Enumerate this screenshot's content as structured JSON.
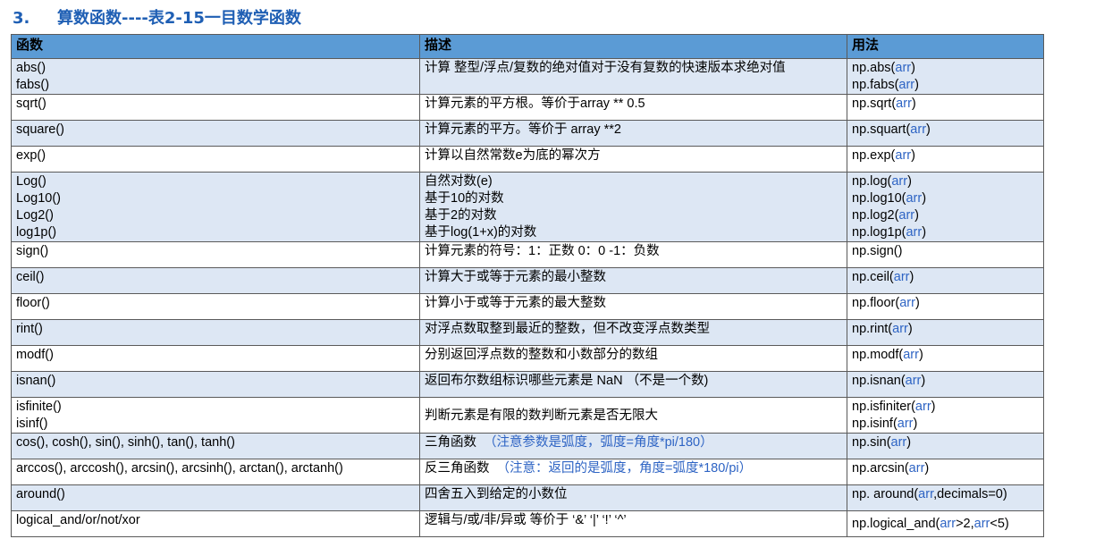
{
  "heading": {
    "number": "3.",
    "title": "算数函数----表2-15一目数学函数"
  },
  "table": {
    "columns": [
      "函数",
      "描述",
      "用法"
    ],
    "rows": [
      {
        "func": [
          "abs()",
          "fabs()"
        ],
        "desc": [
          "计算 整型/浮点/复数的绝对值对于没有复数的快速版本求绝对值"
        ],
        "note": "",
        "usage": [
          [
            "np.abs(",
            "arr",
            ")"
          ],
          [
            "np.fabs(",
            "arr",
            ")"
          ]
        ]
      },
      {
        "func": [
          "sqrt()"
        ],
        "desc": [
          "计算元素的平方根。等价于array ** 0.5"
        ],
        "note": "",
        "usage": [
          [
            "np.sqrt(",
            "arr",
            ")"
          ]
        ]
      },
      {
        "func": [
          "square()"
        ],
        "desc": [
          "计算元素的平方。等价于 array **2"
        ],
        "note": "",
        "usage": [
          [
            "np.squart(",
            "arr",
            ")"
          ]
        ]
      },
      {
        "func": [
          "exp()"
        ],
        "desc": [
          "计算以自然常数e为底的幂次方"
        ],
        "note": "",
        "usage": [
          [
            "np.exp(",
            "arr",
            ")"
          ]
        ]
      },
      {
        "func": [
          "Log()",
          "Log10()",
          "Log2()",
          "log1p()"
        ],
        "desc": [
          "自然对数(e)",
          "基于10的对数",
          "基于2的对数",
          "基于log(1+x)的对数"
        ],
        "note": "",
        "usage": [
          [
            "np.log(",
            "arr",
            ")"
          ],
          [
            "np.log10(",
            "arr",
            ")"
          ],
          [
            "np.log2(",
            "arr",
            ")"
          ],
          [
            "np.log1p(",
            "arr",
            ")"
          ]
        ]
      },
      {
        "func": [
          "sign()"
        ],
        "desc": [
          "计算元素的符号：1：正数 0：0 -1：负数"
        ],
        "note": "",
        "usage": [
          [
            "np.sign()",
            "",
            ""
          ]
        ]
      },
      {
        "func": [
          "ceil()"
        ],
        "desc": [
          "计算大于或等于元素的最小整数"
        ],
        "note": "",
        "usage": [
          [
            "np.ceil(",
            "arr",
            ")"
          ]
        ]
      },
      {
        "func": [
          "floor()"
        ],
        "desc": [
          "计算小于或等于元素的最大整数"
        ],
        "note": "",
        "usage": [
          [
            "np.floor(",
            "arr",
            ")"
          ]
        ]
      },
      {
        "func": [
          "rint()"
        ],
        "desc": [
          "对浮点数取整到最近的整数，但不改变浮点数类型"
        ],
        "note": "",
        "usage": [
          [
            "np.rint(",
            "arr",
            ")"
          ]
        ]
      },
      {
        "func": [
          "modf()"
        ],
        "desc": [
          "分别返回浮点数的整数和小数部分的数组"
        ],
        "note": "",
        "usage": [
          [
            "np.modf(",
            "arr",
            ")"
          ]
        ]
      },
      {
        "func": [
          "isnan()"
        ],
        "desc": [
          "返回布尔数组标识哪些元素是 NaN （不是一个数)"
        ],
        "note": "",
        "usage": [
          [
            "np.isnan(",
            "arr",
            ")"
          ]
        ]
      },
      {
        "func": [
          "isfinite()",
          "isinf()"
        ],
        "desc": [
          "判断元素是有限的数判断元素是否无限大"
        ],
        "note": "",
        "usage": [
          [
            "np.isfiniter(",
            "arr",
            ")"
          ],
          [
            "np.isinf(",
            "arr",
            ")"
          ]
        ]
      },
      {
        "func": [
          "cos(), cosh(), sin(), sinh(), tan(), tanh()"
        ],
        "desc": [
          "三角函数"
        ],
        "note": "（注意参数是弧度，弧度=角度*pi/180）",
        "usage": [
          [
            " np.sin(",
            "arr",
            ")"
          ]
        ]
      },
      {
        "func": [
          "arccos(), arccosh(), arcsin(), arcsinh(), arctan(), arctanh()"
        ],
        "desc": [
          "反三角函数"
        ],
        "note": "（注意：返回的是弧度，角度=弧度*180/pi）",
        "usage": [
          [
            " np.arcsin(",
            "arr",
            ")"
          ]
        ]
      },
      {
        "func": [
          "around()"
        ],
        "desc": [
          "四舍五入到给定的小数位"
        ],
        "note": "",
        "usage": [
          [
            "np. around(",
            "arr",
            ",decimals=0)"
          ]
        ]
      },
      {
        "func": [
          "logical_and/or/not/xor"
        ],
        "desc": [
          "逻辑与/或/非/异或 等价于 ‘&’ ‘|’ ‘!’ ‘^’"
        ],
        "note": "",
        "usage": [
          [
            "np.logical_and(",
            "arr",
            ">2,"
          ],
          [
            "",
            "arr",
            "<5)"
          ]
        ]
      }
    ]
  }
}
